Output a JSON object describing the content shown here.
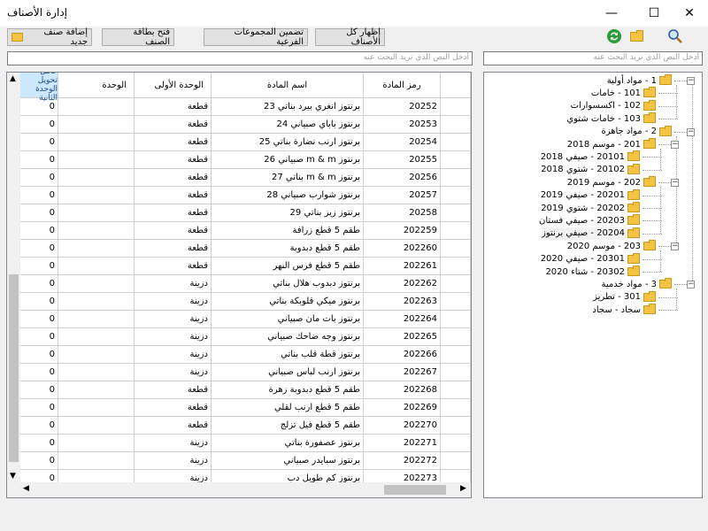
{
  "window": {
    "title": "إدارة الأصناف",
    "minimize": "—",
    "maximize": "☐",
    "close": "✕"
  },
  "toolbar": {
    "add_item": "إضافة صنف جديد",
    "open_card": "فتح بطاقة الصنف",
    "include_subgroups": "تضمين المجموعات الفرعية",
    "show_all": "إظهار كل الأصناف"
  },
  "icons": {
    "refresh": "refresh-icon",
    "folder": "folder-icon",
    "search": "search-icon"
  },
  "search": {
    "grid_placeholder": "أدخل النص الذي تريد البحث عنه",
    "tree_placeholder": "أدخل النص الذي تريد البحث عنه"
  },
  "grid": {
    "headers": {
      "code": "رمز المادة",
      "name": "اسم المادة",
      "unit1": "الوحدة الأولى",
      "unit": "الوحدة",
      "factor": "عامل تحويل الوحدة الثانية"
    },
    "rows": [
      {
        "code": "20252",
        "name": "برنتوز انغري بيرد بناتي 23",
        "unit1": "قطعة",
        "unit": "",
        "factor": "0"
      },
      {
        "code": "20253",
        "name": "برنتوز باباي صبياني 24",
        "unit1": "قطعة",
        "unit": "",
        "factor": "0"
      },
      {
        "code": "20254",
        "name": "برنتوز ارنب نضارة بناتي 25",
        "unit1": "قطعة",
        "unit": "",
        "factor": "0"
      },
      {
        "code": "20255",
        "name": "برنتوز m & m صبياني 26",
        "unit1": "قطعة",
        "unit": "",
        "factor": "0"
      },
      {
        "code": "20256",
        "name": "برنتوز m & m بناتي 27",
        "unit1": "قطعة",
        "unit": "",
        "factor": "0"
      },
      {
        "code": "20257",
        "name": "برنتوز شوارب صبياني 28",
        "unit1": "قطعة",
        "unit": "",
        "factor": "0"
      },
      {
        "code": "20258",
        "name": "برنتوز زيز بناتي 29",
        "unit1": "قطعة",
        "unit": "",
        "factor": "0"
      },
      {
        "code": "202259",
        "name": "طقم 5 قطع زرافة",
        "unit1": "قطعة",
        "unit": "",
        "factor": "0"
      },
      {
        "code": "202260",
        "name": "طقم 5 قطع دبدوبة",
        "unit1": "قطعة",
        "unit": "",
        "factor": "0"
      },
      {
        "code": "202261",
        "name": "طقم 5 قطع فرس النهر",
        "unit1": "قطعة",
        "unit": "",
        "factor": "0"
      },
      {
        "code": "202262",
        "name": "برنتوز دبدوب هلال بناتي",
        "unit1": "دزينة",
        "unit": "",
        "factor": "0"
      },
      {
        "code": "202263",
        "name": "برنتوز ميكي قلوبكة بناتي",
        "unit1": "دزينة",
        "unit": "",
        "factor": "0"
      },
      {
        "code": "202264",
        "name": "برنتوز بات مان صبياني",
        "unit1": "دزينة",
        "unit": "",
        "factor": "0"
      },
      {
        "code": "202265",
        "name": "برنتوز وجه ضاحك صبياني",
        "unit1": "دزينة",
        "unit": "",
        "factor": "0"
      },
      {
        "code": "202266",
        "name": "برنتوز قطة قلب بناتي",
        "unit1": "دزينة",
        "unit": "",
        "factor": "0"
      },
      {
        "code": "202267",
        "name": "برنتوز ارنب لباس صبياني",
        "unit1": "دزينة",
        "unit": "",
        "factor": "0"
      },
      {
        "code": "202268",
        "name": "طقم 5 قطع دبدوبة زهرة",
        "unit1": "قطعة",
        "unit": "",
        "factor": "0"
      },
      {
        "code": "202269",
        "name": "طقم 5 قطع ارنب لقلي",
        "unit1": "قطعة",
        "unit": "",
        "factor": "0"
      },
      {
        "code": "202270",
        "name": "طقم 5 قطع فيل تزلج",
        "unit1": "قطعة",
        "unit": "",
        "factor": "0"
      },
      {
        "code": "202271",
        "name": "برنتوز عصفورة بناتي",
        "unit1": "دزينة",
        "unit": "",
        "factor": "0"
      },
      {
        "code": "202272",
        "name": "برنتوز سبايدر صبياني",
        "unit1": "دزينة",
        "unit": "",
        "factor": "0"
      },
      {
        "code": "202273",
        "name": "برنتوز كم طويل دب",
        "unit1": "دزينة",
        "unit": "",
        "factor": "0"
      }
    ]
  },
  "tree": {
    "nodes": [
      {
        "label": "1 - مواد أولية",
        "level": 0,
        "expanded": true
      },
      {
        "label": "101 - خامات",
        "level": 1
      },
      {
        "label": "102 - اكسسوارات",
        "level": 1
      },
      {
        "label": "103 - خامات شتوي",
        "level": 1
      },
      {
        "label": "2 - مواد جاهزة",
        "level": 0,
        "expanded": true
      },
      {
        "label": "201 - موسم 2018",
        "level": 1,
        "expanded": true
      },
      {
        "label": "20101 - صيفي 2018",
        "level": 2
      },
      {
        "label": "20102 - شتوي 2018",
        "level": 2
      },
      {
        "label": "202 - موسم 2019",
        "level": 1,
        "expanded": true
      },
      {
        "label": "20201 - صيفي 2019",
        "level": 2
      },
      {
        "label": "20202 - شتوي 2019",
        "level": 2
      },
      {
        "label": "20203 - صيفي فستان",
        "level": 2
      },
      {
        "label": "20204 - صيفي برنتوز",
        "level": 2,
        "selected": true
      },
      {
        "label": "203 - موسم 2020",
        "level": 1,
        "expanded": true
      },
      {
        "label": "20301 - صيفي 2020",
        "level": 2
      },
      {
        "label": "20302 - شتاء 2020",
        "level": 2
      },
      {
        "label": "3 - مواد خدمية",
        "level": 0,
        "expanded": true
      },
      {
        "label": "301 - تطريز",
        "level": 1
      },
      {
        "label": "سجاد - سجاد",
        "level": 1
      }
    ]
  },
  "colors": {
    "folder": "#f5c342",
    "selected_header": "#cce8ff",
    "refresh_green": "#2e9a3a"
  }
}
